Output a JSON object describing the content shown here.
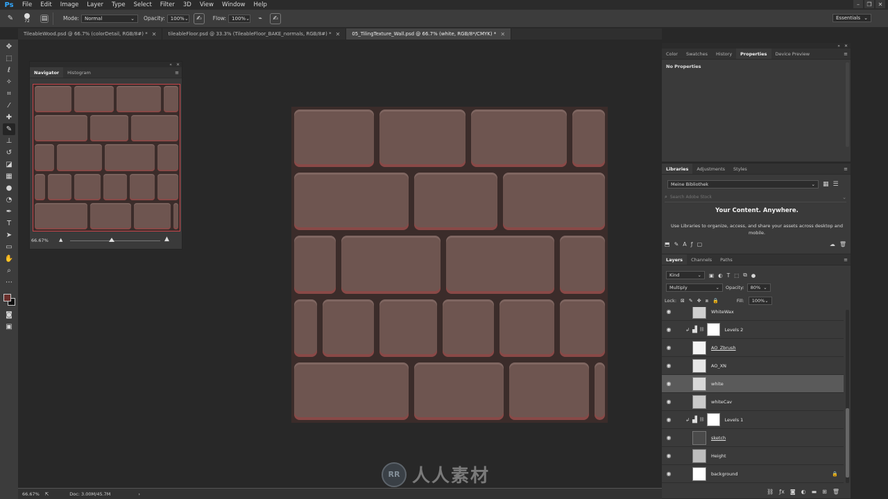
{
  "app": {
    "logo": "Ps"
  },
  "menu": [
    "File",
    "Edit",
    "Image",
    "Layer",
    "Type",
    "Select",
    "Filter",
    "3D",
    "View",
    "Window",
    "Help"
  ],
  "window_controls": [
    "–",
    "❐",
    "✕"
  ],
  "options": {
    "brush_size": "72",
    "mode_label": "Mode:",
    "mode_value": "Normal",
    "opacity_label": "Opacity:",
    "opacity_value": "100%",
    "flow_label": "Flow:",
    "flow_value": "100%",
    "workspace": "Essentials"
  },
  "tabs": [
    {
      "label": "TileableWood.psd @ 66.7% (colorDetail, RGB/8#) *",
      "active": false
    },
    {
      "label": "tileableFloor.psd @ 33.3% (TileableFloor_BAKE_normals, RGB/8#) *",
      "active": false
    },
    {
      "label": "05_TilingTexture_Wall.psd @ 66.7% (white, RGB/8*/CMYK) *",
      "active": true
    }
  ],
  "tools": [
    "move-icon",
    "marquee-icon",
    "lasso-icon",
    "magic-wand-icon",
    "crop-icon",
    "eyedropper-icon",
    "healing-icon",
    "brush-icon",
    "stamp-icon",
    "history-brush-icon",
    "eraser-icon",
    "gradient-icon",
    "blur-icon",
    "dodge-icon",
    "pen-icon",
    "type-icon",
    "path-select-icon",
    "shape-icon",
    "hand-icon",
    "zoom-icon",
    "more-icon"
  ],
  "navigator": {
    "tabs": [
      "Navigator",
      "Histogram"
    ],
    "zoom": "66.67%"
  },
  "status": {
    "zoom": "66.67%",
    "doc": "Doc: 3.00M/45.7M"
  },
  "properties_panel": {
    "tabs": [
      "Color",
      "Swatches",
      "History",
      "Properties",
      "Device Preview"
    ],
    "active_tab": "Properties",
    "empty_text": "No Properties"
  },
  "libraries_panel": {
    "tabs": [
      "Libraries",
      "Adjustments",
      "Styles"
    ],
    "library_name": "Meine Bibliothek",
    "search_placeholder": "Search Adobe Stock",
    "heading": "Your Content. Anywhere.",
    "body": "Use Libraries to organize, access, and share your assets across desktop and mobile."
  },
  "layers_panel": {
    "tabs": [
      "Layers",
      "Channels",
      "Paths"
    ],
    "filter_kind": "Kind",
    "blend_mode": "Multiply",
    "opacity_label": "Opacity:",
    "opacity_value": "80%",
    "lock_label": "Lock:",
    "fill_label": "Fill:",
    "fill_value": "100%",
    "layers": [
      {
        "name": "WhiteWax",
        "type": "pixel",
        "visible": true,
        "selected": false,
        "underline": false
      },
      {
        "name": "Levels 2",
        "type": "adjustment",
        "visible": true,
        "selected": false,
        "underline": false
      },
      {
        "name": "AO_Zbrush",
        "type": "pixel",
        "visible": true,
        "selected": false,
        "underline": true
      },
      {
        "name": "AO_XN",
        "type": "pixel",
        "visible": true,
        "selected": false,
        "underline": false
      },
      {
        "name": "white",
        "type": "pixel",
        "visible": true,
        "selected": true,
        "underline": false
      },
      {
        "name": "whiteCav",
        "type": "pixel",
        "visible": true,
        "selected": false,
        "underline": false
      },
      {
        "name": "Levels 1",
        "type": "adjustment",
        "visible": true,
        "selected": false,
        "underline": false
      },
      {
        "name": "sketch",
        "type": "pixel",
        "visible": true,
        "selected": false,
        "underline": true
      },
      {
        "name": "Height",
        "type": "pixel",
        "visible": true,
        "selected": false,
        "underline": false
      },
      {
        "name": "background",
        "type": "pixel",
        "visible": true,
        "selected": false,
        "underline": false,
        "locked": true
      }
    ]
  },
  "watermark": {
    "logo_text": "RR",
    "text": "人人素材"
  },
  "colors": {
    "accent": "#31a8ff",
    "brick": "#6e5550",
    "mortar": "#3b2c2a",
    "foreground_swatch": "#6a2f2c",
    "background_swatch": "#0d0d0d"
  }
}
